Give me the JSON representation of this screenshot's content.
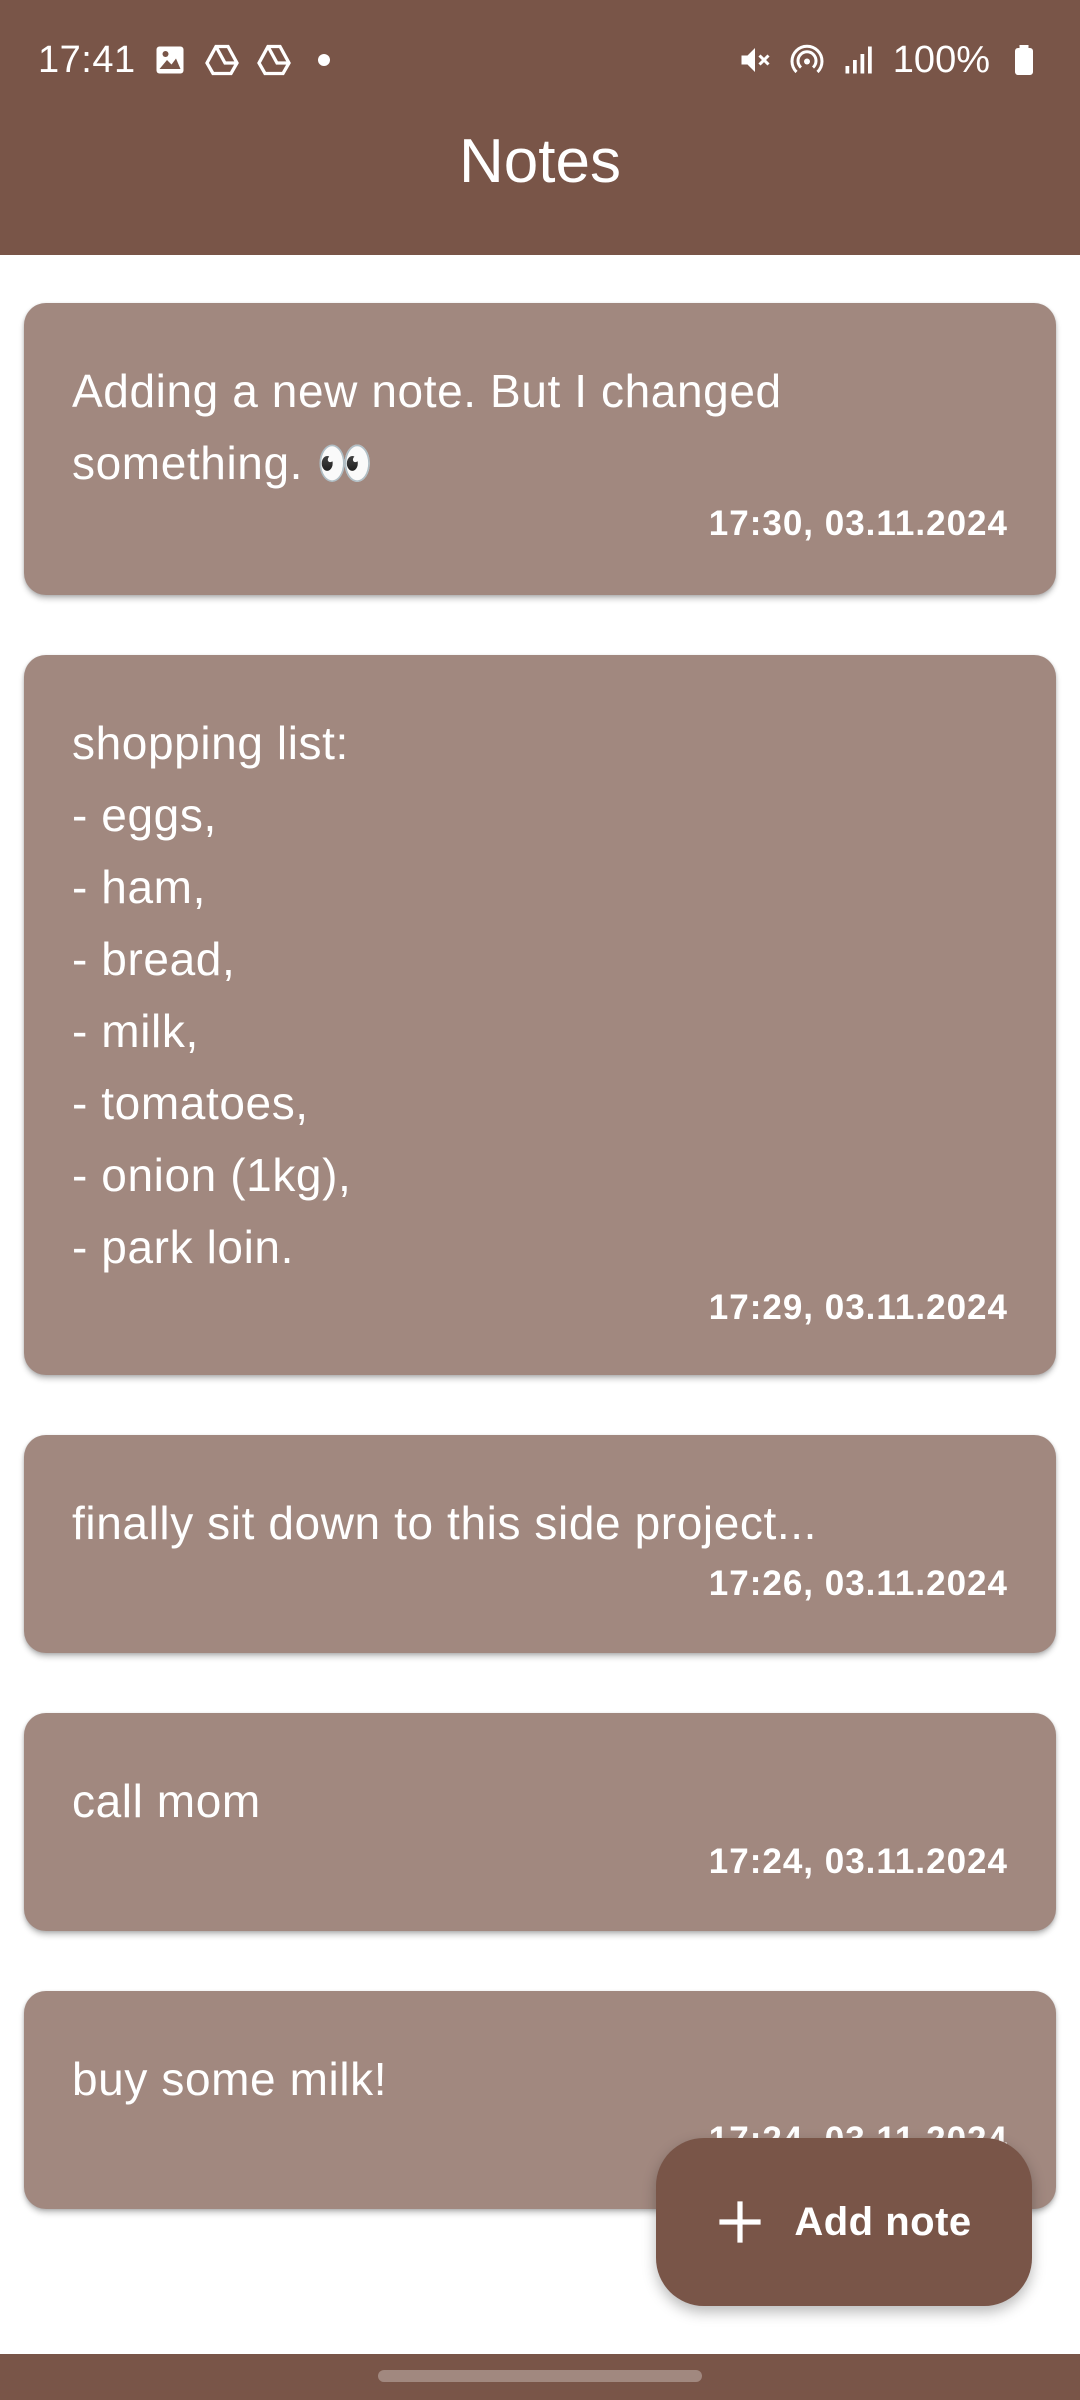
{
  "status_bar": {
    "time": "17:41",
    "battery_text": "100%",
    "left_icons": [
      "gallery-icon",
      "drive-icon",
      "drive-icon",
      "dot-icon"
    ],
    "right_icons": [
      "mute-icon",
      "hotspot-icon",
      "signal-icon",
      "battery-icon"
    ]
  },
  "app_bar": {
    "title": "Notes"
  },
  "notes": [
    {
      "text": "Adding a new note. But I changed something. 👀",
      "timestamp": "17:30, 03.11.2024"
    },
    {
      "text": "shopping list:\n- eggs,\n- ham,\n- bread,\n- milk,\n- tomatoes,\n- onion (1kg),\n- park loin.",
      "timestamp": "17:29, 03.11.2024"
    },
    {
      "text": "finally sit down to this side project...",
      "timestamp": "17:26, 03.11.2024"
    },
    {
      "text": "call mom",
      "timestamp": "17:24, 03.11.2024"
    },
    {
      "text": "buy some milk!",
      "timestamp": "17:24, 03.11.2024"
    }
  ],
  "fab": {
    "label": "Add note",
    "icon": "plus-icon"
  },
  "colors": {
    "primary": "#795548",
    "card": "#a1887f",
    "on_primary": "#ffffff"
  }
}
